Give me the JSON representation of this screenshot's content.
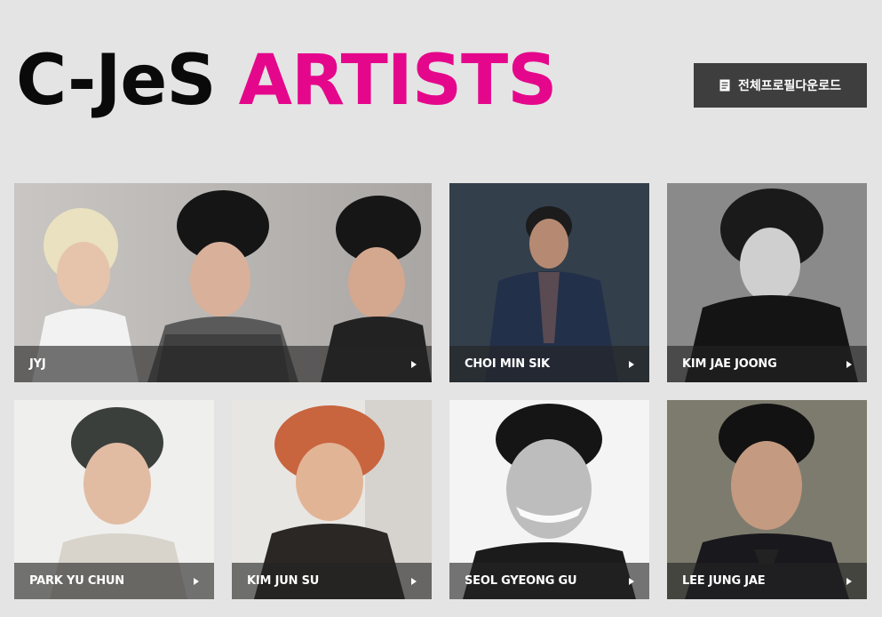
{
  "header": {
    "title_part1": "C-JeS",
    "title_part2": "ARTISTS",
    "download_label": "전체프로필다운로드",
    "download_icon": "document-icon"
  },
  "colors": {
    "background": "#e4e4e4",
    "accent_pink": "#e5078b",
    "button_bg": "#3e3e3e"
  },
  "artists": [
    {
      "name": "JYJ",
      "icon": "arrow-right-icon"
    },
    {
      "name": "CHOI MIN SIK",
      "icon": "arrow-right-icon"
    },
    {
      "name": "KIM JAE JOONG",
      "icon": "arrow-right-icon"
    },
    {
      "name": "PARK YU CHUN",
      "icon": "arrow-right-icon"
    },
    {
      "name": "KIM JUN SU",
      "icon": "arrow-right-icon"
    },
    {
      "name": "SEOL GYEONG GU",
      "icon": "arrow-right-icon"
    },
    {
      "name": "LEE JUNG JAE",
      "icon": "arrow-right-icon"
    }
  ]
}
